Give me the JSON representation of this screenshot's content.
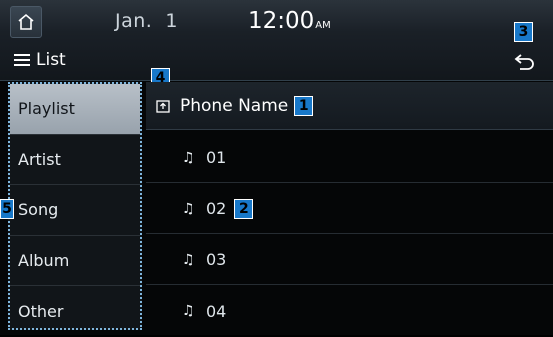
{
  "status": {
    "date": "Jan.  1",
    "time": "12:00",
    "ampm": "AM"
  },
  "header": {
    "list_label": "List"
  },
  "sidebar": {
    "items": [
      {
        "label": "Playlist"
      },
      {
        "label": "Artist"
      },
      {
        "label": "Song"
      },
      {
        "label": "Album"
      },
      {
        "label": "Other"
      }
    ]
  },
  "main": {
    "folder_label": "Phone Name",
    "songs": [
      {
        "label": "01"
      },
      {
        "label": "02"
      },
      {
        "label": "03"
      },
      {
        "label": "04"
      }
    ]
  },
  "callouts": {
    "c1": "1",
    "c2": "2",
    "c3": "3",
    "c4": "4",
    "c5": "5"
  },
  "colors": {
    "callout": "#1878c9",
    "selected_item": "#a8b1ba",
    "focus_outline": "#7fb6dd"
  }
}
